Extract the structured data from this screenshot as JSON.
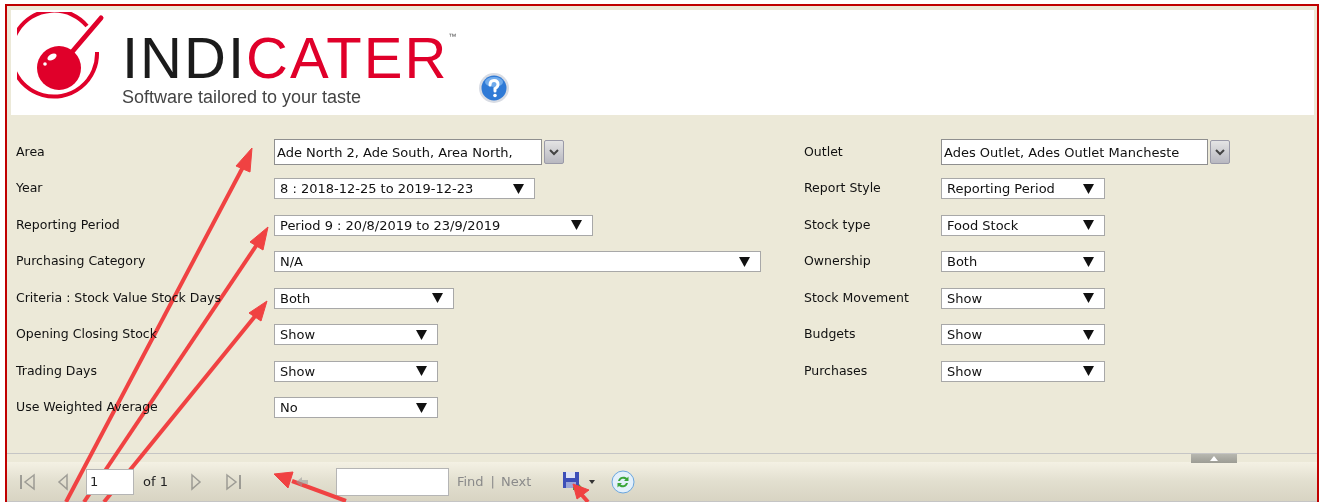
{
  "header": {
    "logo": {
      "dark_part": "INDI",
      "accent_part": "CATER",
      "trademark": "™",
      "tagline": "Software tailored to your taste"
    }
  },
  "form": {
    "left": [
      {
        "label": "Area",
        "kind": "multiselect",
        "value": "Ade North 2, Ade South, Area North,"
      },
      {
        "label": "Year",
        "kind": "select",
        "value": "8 : 2018-12-25 to 2019-12-23"
      },
      {
        "label": "Reporting Period",
        "kind": "select",
        "value": "Period 9 : 20/8/2019 to 23/9/2019"
      },
      {
        "label": "Purchasing Category",
        "kind": "select",
        "value": "N/A"
      },
      {
        "label": "Criteria : Stock Value Stock Days",
        "kind": "select",
        "value": "Both"
      },
      {
        "label": "Opening Closing Stock",
        "kind": "select",
        "value": "Show"
      },
      {
        "label": "Trading Days",
        "kind": "select",
        "value": "Show"
      },
      {
        "label": "Use Weighted Average",
        "kind": "select",
        "value": "No"
      }
    ],
    "right": [
      {
        "label": "Outlet",
        "kind": "multiselect",
        "value": "Ades Outlet, Ades Outlet Mancheste"
      },
      {
        "label": "Report Style",
        "kind": "select",
        "value": "Reporting Period"
      },
      {
        "label": "Stock type",
        "kind": "select",
        "value": "Food Stock"
      },
      {
        "label": "Ownership",
        "kind": "select",
        "value": "Both"
      },
      {
        "label": "Stock Movement",
        "kind": "select",
        "value": "Show"
      },
      {
        "label": "Budgets",
        "kind": "select",
        "value": "Show"
      },
      {
        "label": "Purchases",
        "kind": "select",
        "value": "Show"
      }
    ]
  },
  "toolbar": {
    "first_disabled": true,
    "prev_disabled": true,
    "page": "1",
    "page_count": "of 1",
    "next_disabled": true,
    "last_disabled": true,
    "back_disabled": true,
    "find_label": "Find",
    "separator": "|",
    "next_label": "Next",
    "find_disabled": true
  }
}
